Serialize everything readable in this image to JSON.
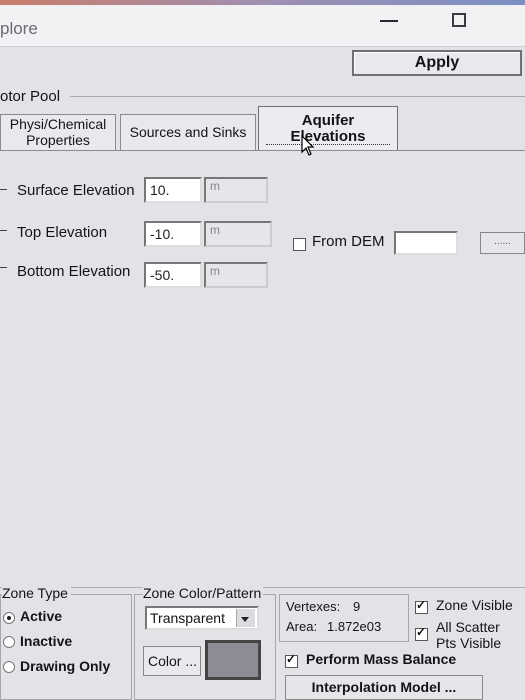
{
  "window": {
    "title": "plore"
  },
  "toolbar": {
    "apply_label": "Apply"
  },
  "group": {
    "label": "otor Pool"
  },
  "tabs": [
    {
      "label_line1": "Physi/Chemical",
      "label_line2": "Properties"
    },
    {
      "label": "Sources and Sinks"
    },
    {
      "label_line1": "Aquifer",
      "label_line2": "Elevations"
    }
  ],
  "elevations": {
    "surface": {
      "label": "Surface Elevation",
      "value": "10.",
      "unit": "m"
    },
    "top": {
      "label": "Top Elevation",
      "value": "-10.",
      "unit": "m"
    },
    "bottom": {
      "label": "Bottom Elevation",
      "value": "-50.",
      "unit": "m"
    }
  },
  "dem": {
    "label": "From DEM",
    "checked": false,
    "value": "",
    "browse_label": "......"
  },
  "zone_type": {
    "legend": "Zone Type",
    "options": [
      "Active",
      "Inactive",
      "Drawing Only"
    ],
    "selected": "Active"
  },
  "zone_color": {
    "legend": "Zone Color/Pattern",
    "pattern_value": "Transparent",
    "color_button_label": "Color ...",
    "swatch_color": "#8d8b93"
  },
  "stats": {
    "vertexes_label": "Vertexes:",
    "vertexes_value": "9",
    "area_label": "Area:",
    "area_value": "1.872e03"
  },
  "visibility": {
    "zone_visible": "Zone Visible",
    "all_scatter_line1": "All Scatter",
    "all_scatter_line2": "Pts Visible"
  },
  "mass_balance": {
    "label": "Perform Mass Balance",
    "checked": true
  },
  "interpolation": {
    "label": "Interpolation Model ..."
  }
}
